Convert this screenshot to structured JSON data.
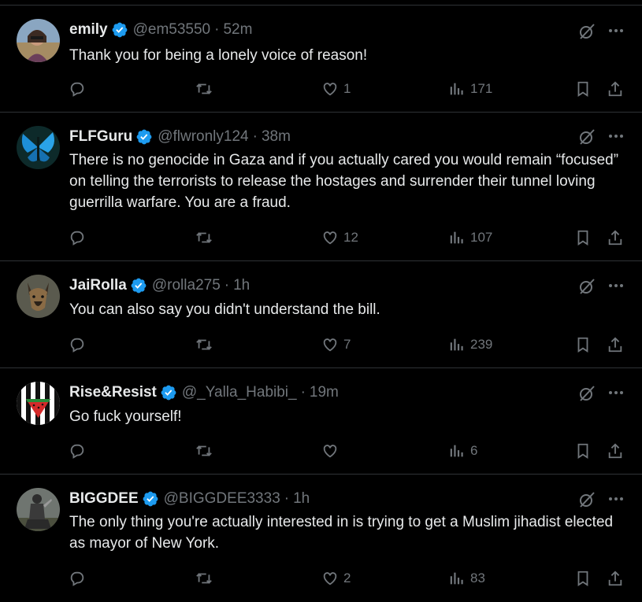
{
  "colors": {
    "background": "#000000",
    "text": "#e7e9ea",
    "muted": "#71767b",
    "divider": "#2f3336",
    "verified": "#1d9bf0"
  },
  "icons": {
    "reply": "reply-icon",
    "retweet": "retweet-icon",
    "like": "like-icon",
    "views": "views-icon",
    "bookmark": "bookmark-icon",
    "share": "share-icon",
    "grok": "grok-icon",
    "more": "more-icon",
    "verified": "verified-badge-icon"
  },
  "tweets": [
    {
      "name": "emily",
      "handle": "@em53550",
      "dot": "·",
      "time": "52m",
      "text": "Thank you for being a lonely voice of reason!",
      "replies": "",
      "reposts": "",
      "likes": "1",
      "views": "171"
    },
    {
      "name": "FLFGuru",
      "handle": "@flwronly124",
      "dot": "·",
      "time": "38m",
      "text": "There is no genocide in Gaza and if you actually cared you would remain “focused” on telling the terrorists to release the hostages and surrender their tunnel loving guerrilla warfare. You are a fraud.",
      "replies": "",
      "reposts": "",
      "likes": "12",
      "views": "107"
    },
    {
      "name": "JaiRolla",
      "handle": "@rolla275",
      "dot": "·",
      "time": "1h",
      "text": "You can also say you didn't understand the bill.",
      "replies": "",
      "reposts": "",
      "likes": "7",
      "views": "239"
    },
    {
      "name": "Rise&Resist",
      "handle": "@_Yalla_Habibi_",
      "dot": "·",
      "time": "19m",
      "text": "Go fuck yourself!",
      "replies": "",
      "reposts": "",
      "likes": "",
      "views": "6"
    },
    {
      "name": "BIGGDEE",
      "handle": "@BIGGDEE3333",
      "dot": "·",
      "time": "1h",
      "text": "The only thing you're actually interested in is trying to get a Muslim jihadist elected as mayor of New York.",
      "replies": "",
      "reposts": "",
      "likes": "2",
      "views": "83"
    }
  ]
}
